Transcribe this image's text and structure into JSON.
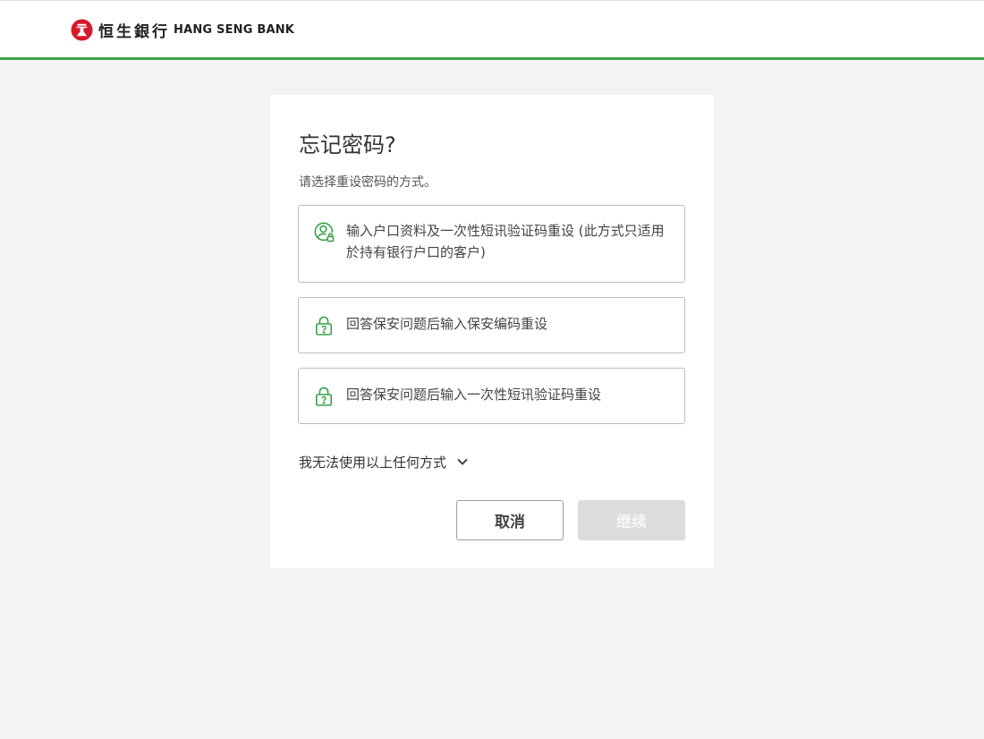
{
  "header": {
    "brand_cn": "恒生銀行",
    "brand_en": "HANG SENG BANK",
    "accent_color": "#3aa34a",
    "logo_color": "#d7182a"
  },
  "dialog": {
    "title": "忘记密码?",
    "subtitle": "请选择重设密码的方式。",
    "options": [
      {
        "icon": "user-lock-icon",
        "label": "输入户口资料及一次性短讯验证码重设 (此方式只适用於持有银行户口的客户)"
      },
      {
        "icon": "padlock-question-icon",
        "label": "回答保安问题后输入保安编码重设"
      },
      {
        "icon": "padlock-question-icon",
        "label": "回答保安问题后输入一次性短讯验证码重设"
      }
    ],
    "expander_label": "我无法使用以上任何方式",
    "cancel_label": "取消",
    "continue_label": "继续"
  }
}
